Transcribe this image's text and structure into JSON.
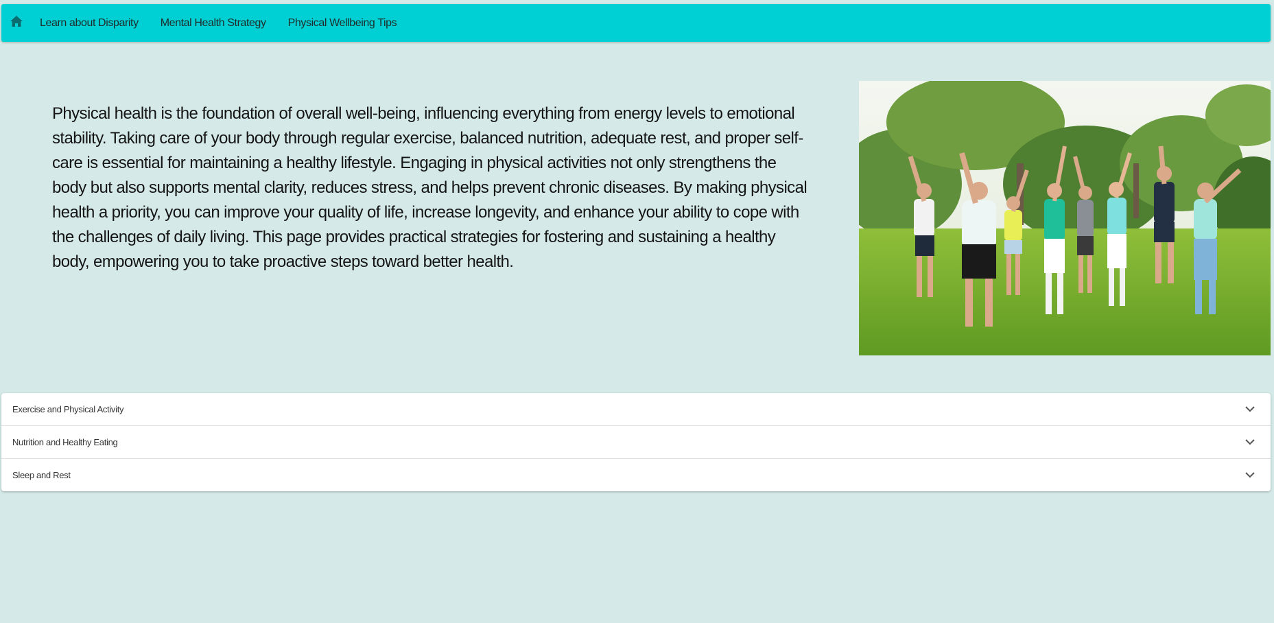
{
  "nav": {
    "home_icon": "home-icon",
    "links": [
      "Learn about Disparity",
      "Mental Health Strategy",
      "Physical Wellbeing Tips"
    ]
  },
  "intro": {
    "text": "Physical health is the foundation of overall well-being, influencing everything from energy levels to emotional stability. Taking care of your body through regular exercise, balanced nutrition, adequate rest, and proper self-care is essential for maintaining a healthy lifestyle. Engaging in physical activities not only strengthens the body but also supports mental clarity, reduces stress, and helps prevent chronic diseases. By making physical health a priority, you can improve your quality of life, increase longevity, and enhance your ability to cope with the challenges of daily living. This page provides practical strategies for fostering and sustaining a healthy body, empowering you to take proactive steps toward better health."
  },
  "accordion": {
    "items": [
      "Exercise and Physical Activity",
      "Nutrition and Healthy Eating",
      "Sleep and Rest"
    ],
    "icon": "chevron-down-icon"
  },
  "colors": {
    "navbar": "#00d0d3",
    "background": "#d5eae8",
    "panel": "#ffffff"
  }
}
